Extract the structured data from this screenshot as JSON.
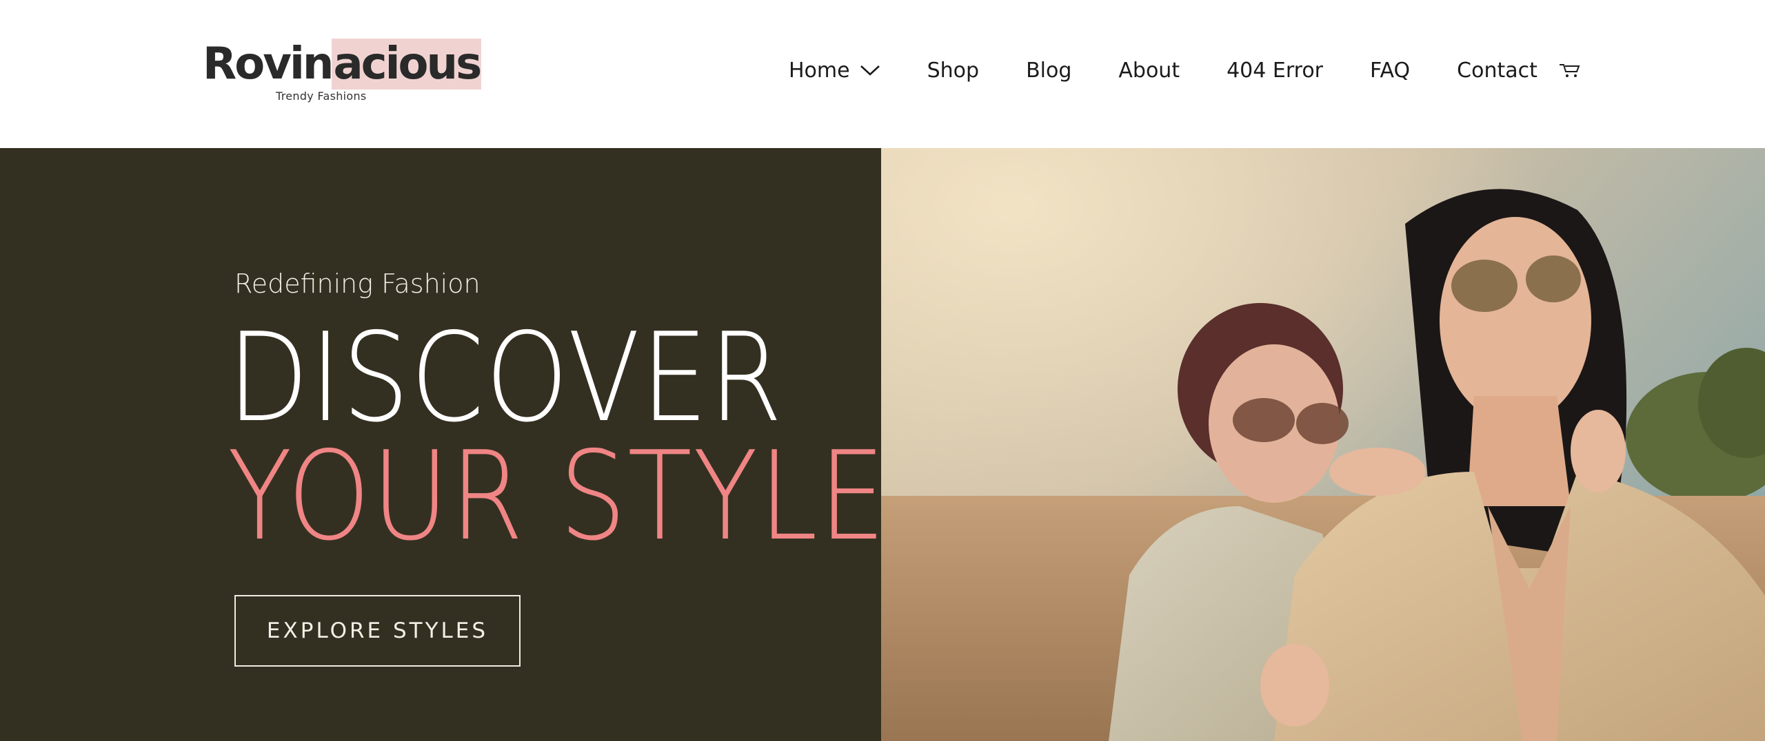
{
  "brand": {
    "name_part1": "Rovin",
    "name_part2": "acious",
    "tagline": "Trendy Fashions",
    "highlight_color": "#f0d3d1"
  },
  "nav": {
    "items": [
      {
        "label": "Home",
        "has_dropdown": true
      },
      {
        "label": "Shop"
      },
      {
        "label": "Blog"
      },
      {
        "label": "About"
      },
      {
        "label": "404 Error"
      },
      {
        "label": "FAQ"
      },
      {
        "label": "Contact"
      }
    ],
    "cart_icon": "cart-icon",
    "dropdown_icon": "chevron-down-icon"
  },
  "hero": {
    "eyebrow": "Redefining Fashion",
    "headline_line1": "DISCOVER",
    "headline_line2": "YOUR STYLE",
    "cta_label": "EXPLORE STYLES",
    "background_color": "#343021",
    "accent_color": "#f08585",
    "image_alt": "two-women-in-sunglasses-and-blazers-in-wheat-field"
  }
}
